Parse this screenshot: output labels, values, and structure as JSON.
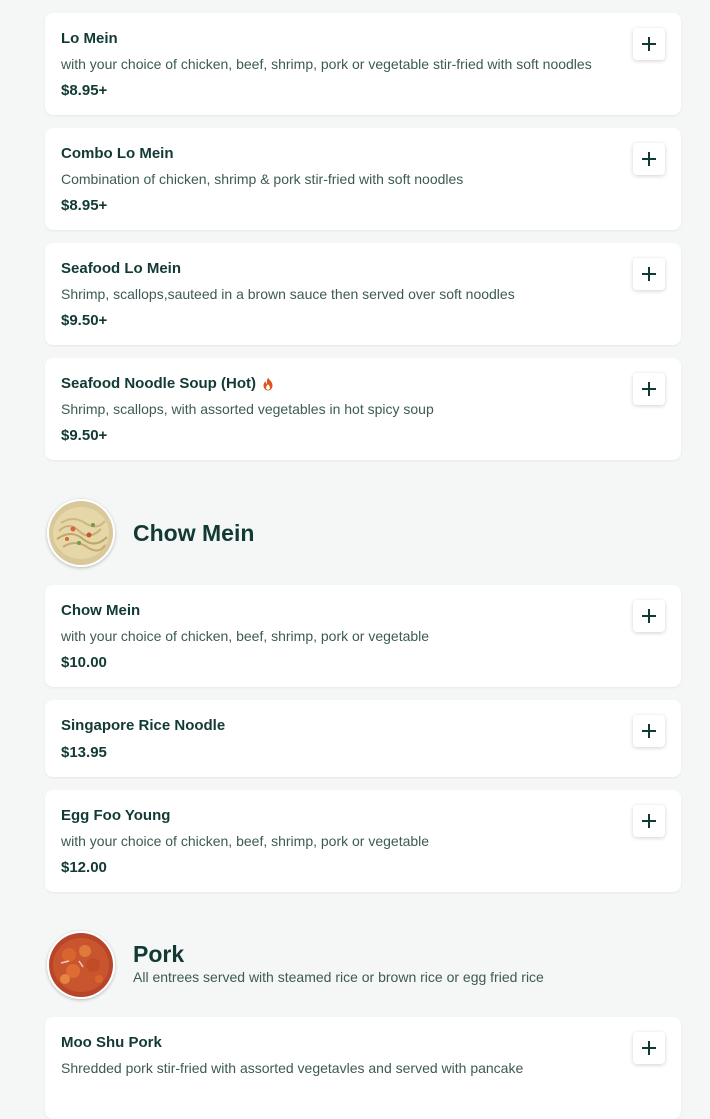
{
  "colors": {
    "background": "#f5f6f6",
    "card": "#ffffff",
    "text_dark": "#123a34",
    "text_muted": "#3d5a55",
    "spicy": "#e0541c"
  },
  "top_items": [
    {
      "name": "Lo Mein",
      "description": "with your choice of chicken, beef, shrimp, pork or vegetable stir-fried with soft noodles",
      "price": "$8.95+"
    },
    {
      "name": "Combo Lo Mein",
      "description": "Combination of chicken, shrimp & pork stir-fried with soft noodles",
      "price": "$8.95+"
    },
    {
      "name": "Seafood Lo Mein",
      "description": "Shrimp, scallops,sauteed in a brown sauce then served over soft noodles",
      "price": "$9.50+"
    },
    {
      "name": "Seafood Noodle Soup (Hot)",
      "description": "Shrimp, scallops, with assorted vegetables in hot spicy soup",
      "price": "$9.50+",
      "icon": "flame-icon"
    }
  ],
  "chow_mein_section": {
    "title": "Chow Mein",
    "items": [
      {
        "name": "Chow Mein",
        "description": "with your choice of chicken, beef, shrimp, pork or vegetable",
        "price": "$10.00"
      },
      {
        "name": "Singapore Rice Noodle",
        "price": "$13.95"
      },
      {
        "name": "Egg Foo Young",
        "description": "with your choice of chicken, beef, shrimp, pork or vegetable",
        "price": "$12.00"
      }
    ]
  },
  "pork_section": {
    "title": "Pork",
    "subtitle": "All entrees served with steamed rice or brown rice or egg fried rice",
    "items": [
      {
        "name": "Moo Shu Pork",
        "description": "Shredded pork stir-fried with assorted vegetavles and served with pancake",
        "price": ""
      }
    ]
  },
  "add_button_icon": "plus-icon"
}
